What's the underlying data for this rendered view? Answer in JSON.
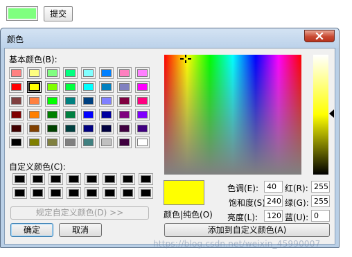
{
  "top": {
    "preview_color": "#7fff7f",
    "submit_label": "提交"
  },
  "dialog": {
    "title": "颜色",
    "close_icon": "close-x-icon",
    "basic_colors_label": "基本颜色(B):",
    "basic_colors": [
      [
        "#ff8080",
        "#ffff80",
        "#80ff80",
        "#00ff80",
        "#80ffff",
        "#0080ff",
        "#ff80c0",
        "#ff80ff"
      ],
      [
        "#ff0000",
        "#ffff00",
        "#80ff00",
        "#00ff40",
        "#00ffff",
        "#0080c0",
        "#8080c0",
        "#ff00ff"
      ],
      [
        "#804040",
        "#ff8040",
        "#00ff00",
        "#008080",
        "#004080",
        "#8080ff",
        "#800040",
        "#ff0080"
      ],
      [
        "#800000",
        "#ff8000",
        "#008000",
        "#008040",
        "#0000ff",
        "#0000a0",
        "#800080",
        "#8000ff"
      ],
      [
        "#400000",
        "#804000",
        "#004000",
        "#004040",
        "#000080",
        "#000040",
        "#400040",
        "#400080"
      ],
      [
        "#000000",
        "#808000",
        "#808040",
        "#808080",
        "#408080",
        "#c0c0c0",
        "#400040",
        "#ffffff"
      ]
    ],
    "selected_basic": {
      "row": 1,
      "col": 1
    },
    "custom_colors_label": "自定义颜色(C):",
    "custom_colors": [
      [
        "#000000",
        "#000000",
        "#000000",
        "#000000",
        "#000000",
        "#000000",
        "#000000",
        "#000000"
      ],
      [
        "#000000",
        "#000000",
        "#000000",
        "#000000",
        "#000000",
        "#000000",
        "#000000",
        "#000000"
      ]
    ],
    "define_custom_label": "规定自定义颜色(D) >>",
    "ok_label": "确定",
    "cancel_label": "取消",
    "color_solid_label": "颜色|纯色(O)",
    "current_color": "#ffff00",
    "hue_label": "色调(E):",
    "hue_value": "40",
    "sat_label": "饱和度(S):",
    "sat_value": "240",
    "lum_label": "亮度(L):",
    "lum_value": "120",
    "red_label": "红(R):",
    "red_value": "255",
    "green_label": "绿(G):",
    "green_value": "255",
    "blue_label": "蓝(U):",
    "blue_value": "0",
    "add_custom_label": "添加到自定义颜色(A)"
  },
  "watermark": "https://blog.csdn.net/weixin_45990007"
}
